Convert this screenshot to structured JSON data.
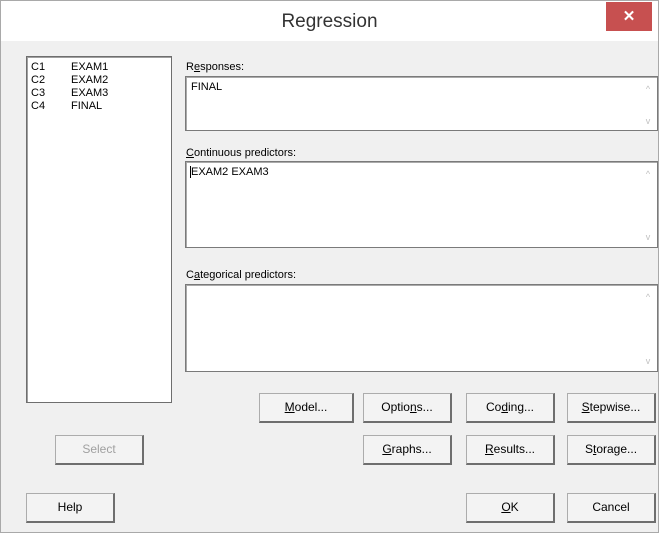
{
  "dialog": {
    "title": "Regression",
    "close_glyph": "✕"
  },
  "columns": [
    {
      "id": "C1",
      "name": "EXAM1"
    },
    {
      "id": "C2",
      "name": "EXAM2"
    },
    {
      "id": "C3",
      "name": "EXAM3"
    },
    {
      "id": "C4",
      "name": "FINAL"
    }
  ],
  "responses": {
    "label_pre": "R",
    "label_key": "e",
    "label_post": "sponses:",
    "value": "FINAL"
  },
  "continuous": {
    "label_pre": "",
    "label_key": "C",
    "label_post": "ontinuous predictors:",
    "value": "EXAM2 EXAM3"
  },
  "categorical": {
    "label_pre": "C",
    "label_key": "a",
    "label_post": "tegorical predictors:",
    "value": ""
  },
  "buttons": {
    "model": {
      "pre": "",
      "key": "M",
      "post": "odel..."
    },
    "options": {
      "pre": "Optio",
      "key": "n",
      "post": "s..."
    },
    "coding": {
      "pre": "Co",
      "key": "d",
      "post": "ing..."
    },
    "stepwise": {
      "pre": "",
      "key": "S",
      "post": "tepwise..."
    },
    "graphs": {
      "pre": "",
      "key": "G",
      "post": "raphs..."
    },
    "results": {
      "pre": "",
      "key": "R",
      "post": "esults..."
    },
    "storage": {
      "pre": "S",
      "key": "t",
      "post": "orage..."
    },
    "ok": {
      "pre": "",
      "key": "O",
      "post": "K"
    },
    "cancel": "Cancel",
    "select": "Select",
    "help": "Help"
  },
  "icons": {
    "scroll_up": "^",
    "scroll_down": "v"
  },
  "colors": {
    "close_button": "#c75050",
    "dialog_background": "#f0f0f0"
  }
}
